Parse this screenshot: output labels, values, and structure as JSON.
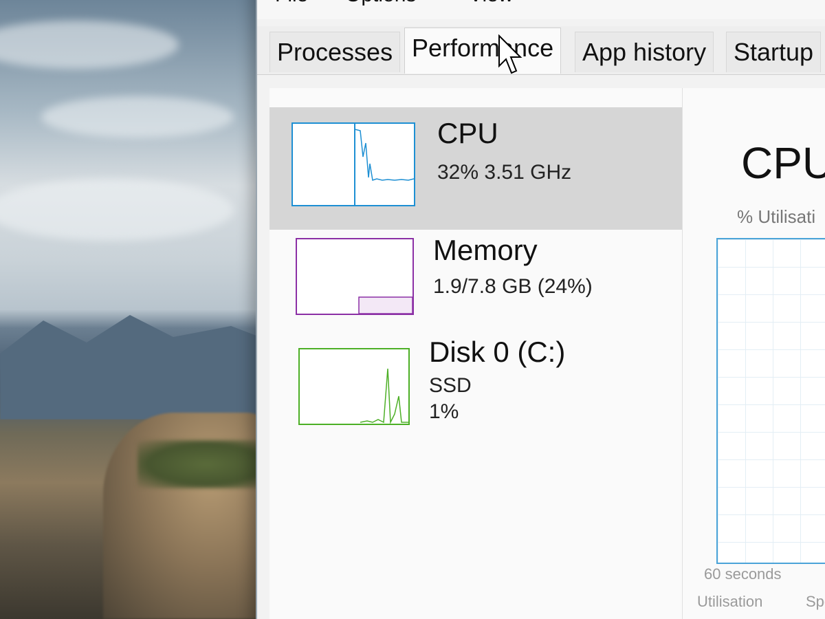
{
  "menu": {
    "file": "File",
    "options": "Options",
    "view": "View"
  },
  "tabs": [
    {
      "label": "Processes"
    },
    {
      "label": "Performance"
    },
    {
      "label": "App history"
    },
    {
      "label": "Startup"
    }
  ],
  "resources": [
    {
      "title": "CPU",
      "line1": "32% 3.51 GHz",
      "line2": "",
      "color": "#1d8fd3"
    },
    {
      "title": "Memory",
      "line1": "1.9/7.8 GB (24%)",
      "line2": "",
      "color": "#8b2fa5"
    },
    {
      "title": "Disk 0 (C:)",
      "line1": "SSD",
      "line2": "1%",
      "color": "#4caf25"
    }
  ],
  "detail": {
    "title": "CPU",
    "subtitle": "% Utilisati",
    "time_label": "60 seconds",
    "utilisation_label": "Utilisation",
    "speed_label": "Speed"
  }
}
